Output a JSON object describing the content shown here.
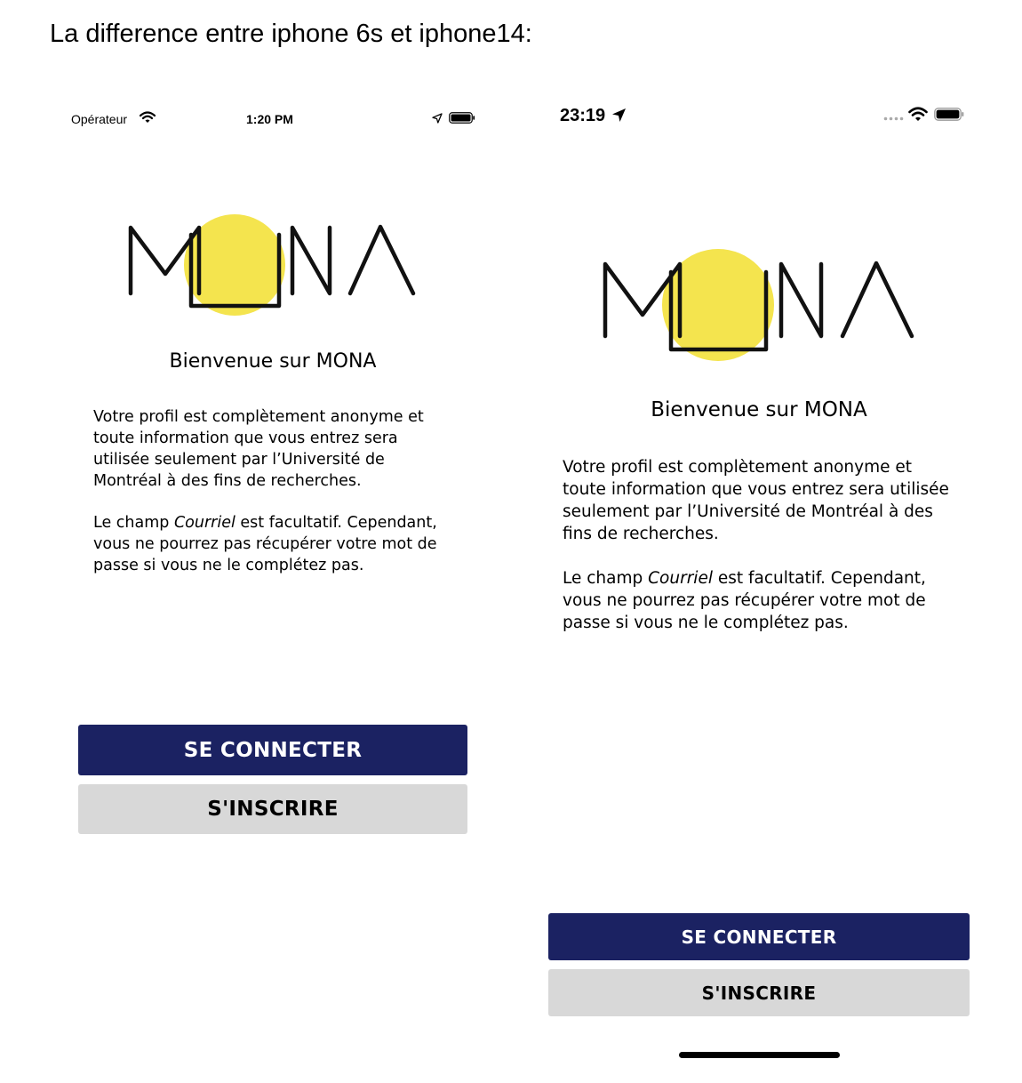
{
  "heading": "La difference entre iphone 6s et iphone14:",
  "colors": {
    "primary_button": "#1b2262",
    "secondary_button": "#d8d8d8",
    "logo_circle": "#f4e44e"
  },
  "iphone6s": {
    "status_bar": {
      "carrier": "Opérateur",
      "time": "1:20 PM",
      "icons": [
        "wifi-icon",
        "location-arrow-icon",
        "battery-icon"
      ]
    },
    "logo": {
      "letters": "MONA"
    },
    "welcome": "Bienvenue sur MONA",
    "paragraph1": "Votre profil est complètement anonyme et toute information que vous entrez sera utilisée seulement par l’Université de Montréal à des fins de recherches.",
    "paragraph2": {
      "before": "Le champ ",
      "emphasis": "Courriel",
      "after": " est facultatif. Cependant, vous ne pourrez pas récupérer votre mot de passe si vous ne le complétez pas."
    },
    "buttons": {
      "login": "SE CONNECTER",
      "register": "S'INSCRIRE"
    }
  },
  "iphone14": {
    "status_bar": {
      "time": "23:19",
      "icons": [
        "location-arrow-icon",
        "signal-dots-icon",
        "wifi-icon",
        "battery-icon"
      ]
    },
    "logo": {
      "letters": "MONA"
    },
    "welcome": "Bienvenue sur MONA",
    "paragraph1": "Votre profil est complètement anonyme et toute information que vous entrez sera utilisée seulement par l’Université de Montréal à des fins de recherches.",
    "paragraph2": {
      "before": "Le champ ",
      "emphasis": "Courriel",
      "after": " est facultatif. Cependant, vous ne pourrez pas récupérer votre mot de passe si vous ne le complétez pas."
    },
    "buttons": {
      "login": "SE CONNECTER",
      "register": "S'INSCRIRE"
    }
  }
}
